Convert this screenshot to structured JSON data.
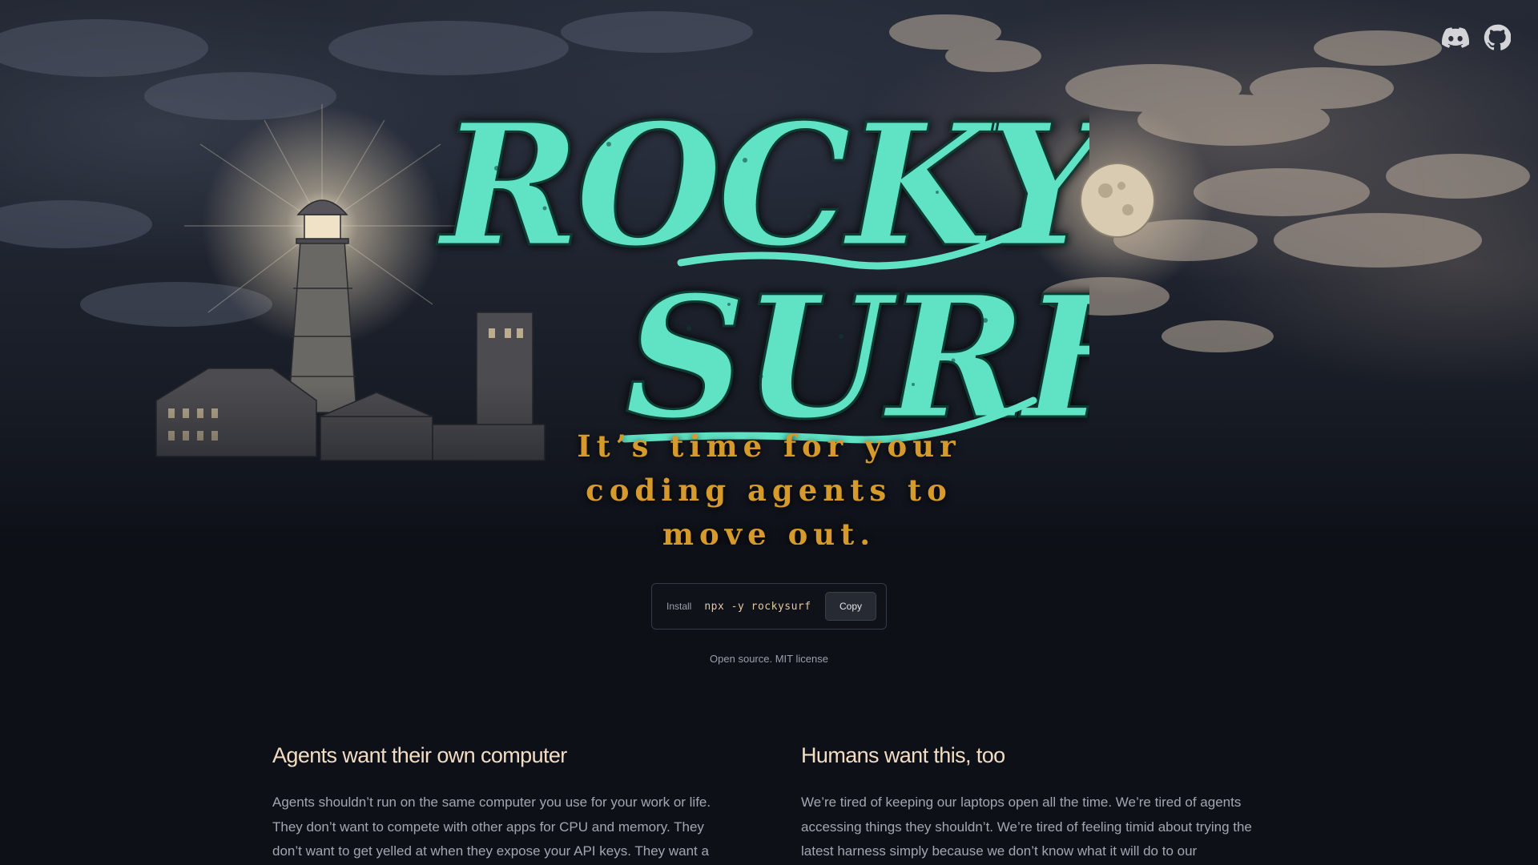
{
  "nav": {
    "icons": [
      {
        "name": "discord-icon"
      },
      {
        "name": "github-icon"
      }
    ]
  },
  "hero": {
    "logo_line1": "ROCKY",
    "logo_line2": "SURF",
    "tagline_lines": [
      "It’s time for your",
      "coding agents to",
      "move out."
    ]
  },
  "install": {
    "label": "Install",
    "command": "npx -y rockysurf",
    "copy_label": "Copy"
  },
  "license": "Open source. MIT license",
  "features": [
    {
      "title": "Agents want their own computer",
      "body": "Agents shouldn’t run on the same computer you use for your work or life. They don’t want to compete with other apps for CPU and memory. They don’t want to get yelled at when they expose your API keys. They want a"
    },
    {
      "title": "Humans want this, too",
      "body": "We’re tired of keeping our laptops open all the time. We’re tired of agents accessing things they shouldn’t. We’re tired of feeling timid about trying the latest harness simply because we don’t know what it will do to our computer."
    }
  ],
  "colors": {
    "background": "#0d1017",
    "logo_teal": "#5fe3c4",
    "tagline_gold": "#d69a2c",
    "heading": "#f2dcc3",
    "body_text": "#a2a6ae"
  }
}
